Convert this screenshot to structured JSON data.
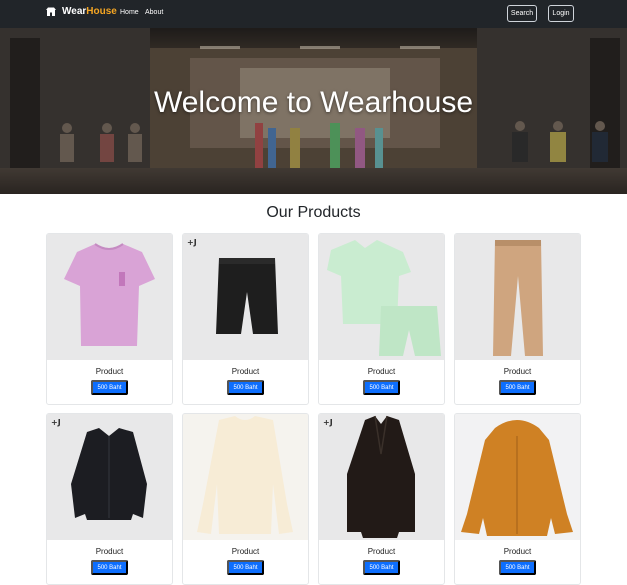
{
  "nav": {
    "brand_part1": "Wear",
    "brand_part2": "House",
    "links": [
      "Home",
      "About"
    ],
    "search_label": "Search",
    "login_label": "Login",
    "brand_icon": "store-icon"
  },
  "hero": {
    "title": "Welcome to Wearhouse"
  },
  "products_section": {
    "title": "Our Products"
  },
  "products": [
    {
      "name": "Product",
      "price": "500 Baht",
      "image": "pink-tshirt",
      "tag": ""
    },
    {
      "name": "Product",
      "price": "500 Baht",
      "image": "black-shorts",
      "tag": "+J"
    },
    {
      "name": "Product",
      "price": "500 Baht",
      "image": "mint-pajama-set",
      "tag": ""
    },
    {
      "name": "Product",
      "price": "500 Baht",
      "image": "khaki-pants",
      "tag": ""
    },
    {
      "name": "Product",
      "price": "500 Baht",
      "image": "black-shirt-jacket",
      "tag": "+J"
    },
    {
      "name": "Product",
      "price": "500 Baht",
      "image": "cream-sweater",
      "tag": ""
    },
    {
      "name": "Product",
      "price": "500 Baht",
      "image": "black-coat",
      "tag": "+J"
    },
    {
      "name": "Product",
      "price": "500 Baht",
      "image": "orange-parka",
      "tag": ""
    }
  ],
  "colors": {
    "navbar": "#212529",
    "brand_accent": "#f5a623",
    "price_button": "#0d6efd"
  }
}
